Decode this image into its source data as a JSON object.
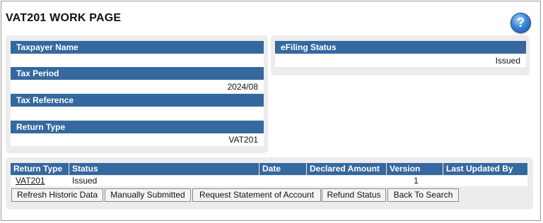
{
  "page": {
    "title": "VAT201 WORK PAGE",
    "help_icon": "question-mark-icon",
    "help_glyph": "?"
  },
  "taxpayer_panel": {
    "taxpayer_name_label": "Taxpayer Name",
    "taxpayer_name_value": "",
    "tax_period_label": "Tax Period",
    "tax_period_value": "2024/08",
    "tax_reference_label": "Tax Reference",
    "tax_reference_value": "",
    "return_type_label": "Return Type",
    "return_type_value": "VAT201"
  },
  "efiling_panel": {
    "label": "eFiling Status",
    "value": "Issued"
  },
  "returns_table": {
    "headers": [
      "Return Type",
      "Status",
      "Date",
      "Declared Amount",
      "Version",
      "Last Updated By"
    ],
    "rows": [
      {
        "return_type": "VAT201",
        "status": "Issued",
        "date": "",
        "declared_amount": "",
        "version": "1",
        "last_updated_by": ""
      }
    ]
  },
  "actions": {
    "refresh": "Refresh Historic Data",
    "manual": "Manually Submitted",
    "statement": "Request Statement of Account",
    "refund": "Refund Status",
    "back": "Back To Search"
  },
  "colors": {
    "header_blue": "#35689f",
    "panel_gray": "#ececec"
  }
}
